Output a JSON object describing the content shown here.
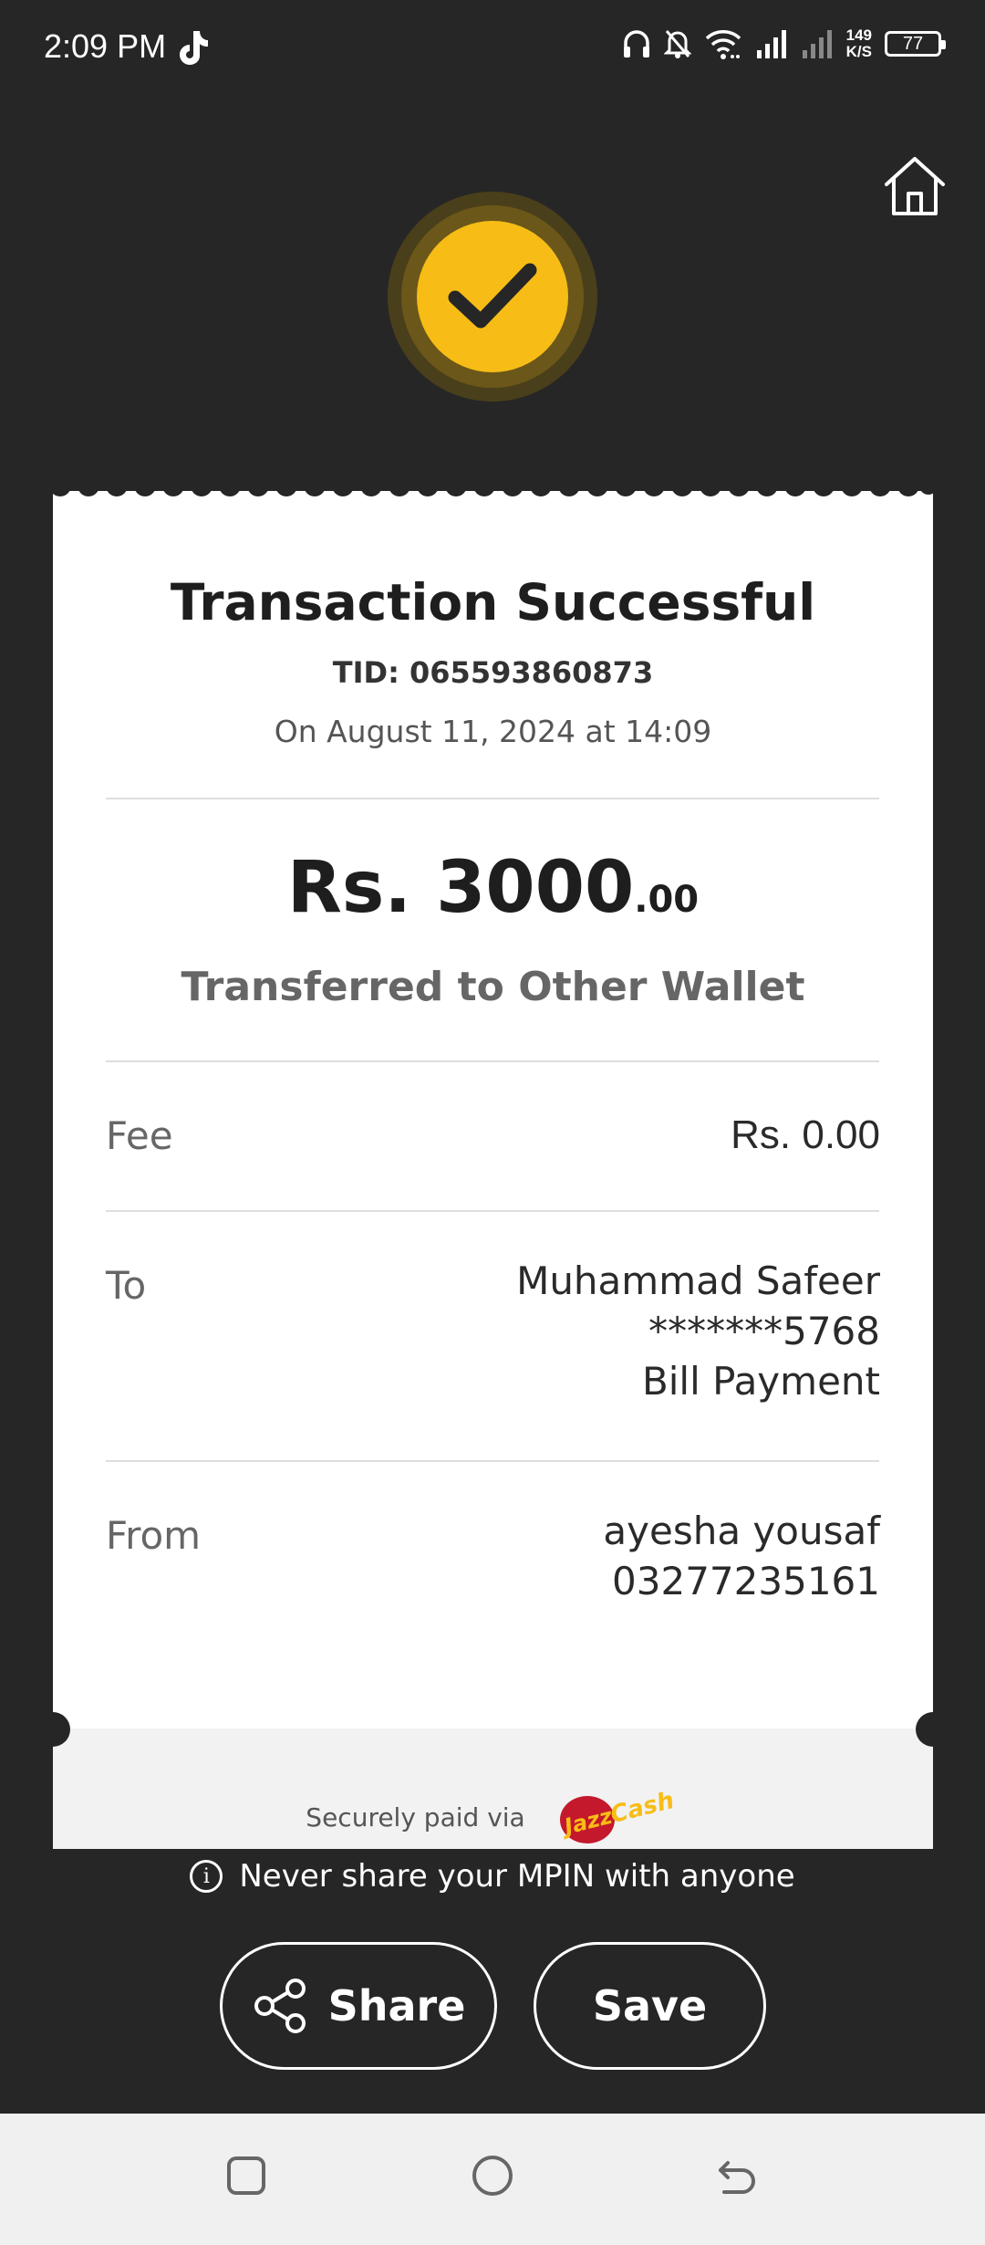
{
  "status_bar": {
    "time": "2:09 PM",
    "speed_top": "149",
    "speed_bottom": "K/S",
    "battery": "77",
    "icons": [
      "tiktok-icon",
      "headphones-icon",
      "bell-off-icon",
      "wifi-icon",
      "signal-icon",
      "signal-icon-2",
      "battery-icon"
    ]
  },
  "receipt": {
    "title": "Transaction Successful",
    "tid": "TID: 065593860873",
    "date": "On August 11, 2024 at 14:09",
    "amount_main": "Rs. 3000",
    "amount_decimal": ".00",
    "description": "Transferred to Other Wallet",
    "fee_label": "Fee",
    "fee_value": "Rs. 0.00",
    "to_label": "To",
    "to_name": "Muhammad Safeer",
    "to_account": "*******5768",
    "to_type": "Bill Payment",
    "from_label": "From",
    "from_name": "ayesha yousaf",
    "from_account": "03277235161",
    "secure_text": "Securely paid via",
    "brand_logo": "JazzCash"
  },
  "warning": "Never share your MPIN with anyone",
  "buttons": {
    "share": "Share",
    "save": "Save"
  },
  "colors": {
    "background": "#262626",
    "accent": "#f7bd16"
  }
}
